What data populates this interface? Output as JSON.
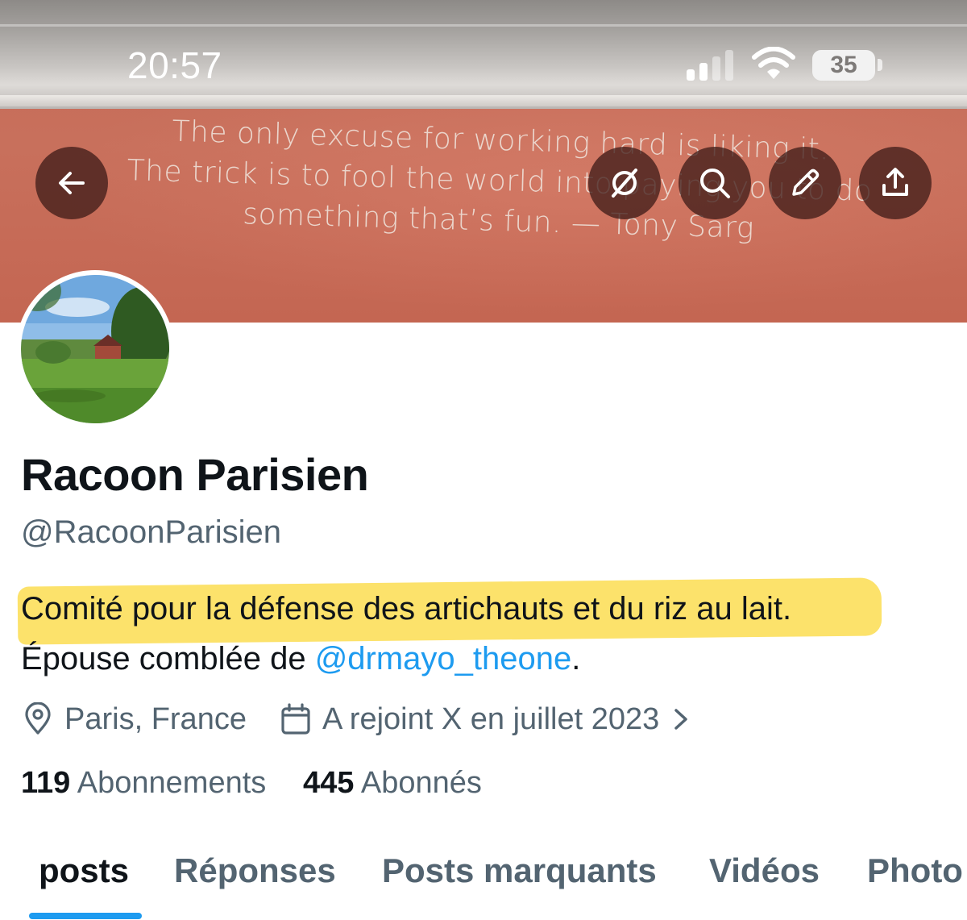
{
  "status_bar": {
    "time": "20:57",
    "battery_level": "35",
    "signal_icon": "cellular-signal-icon",
    "wifi_icon": "wifi-icon"
  },
  "banner": {
    "quote_lines": [
      "The only excuse for working hard is liking it.",
      "The trick is to fool the world into paying you to do",
      "something that’s fun. — Tony Sarg"
    ]
  },
  "header_buttons": {
    "back_icon": "arrow-left-icon",
    "grok_icon": "grok-icon",
    "search_icon": "search-icon",
    "edit_icon": "pencil-icon",
    "share_icon": "share-icon"
  },
  "profile": {
    "display_name": "Racoon Parisien",
    "handle": "@RacoonParisien",
    "bio_line1": "Comité pour la défense des artichauts et du riz au lait.",
    "bio_line2_prefix": "Épouse comblée de ",
    "bio_mention": "@drmayo_theone",
    "bio_line2_suffix": ".",
    "location": "Paris, France",
    "joined": "A rejoint X en juillet 2023",
    "following_count": "119",
    "following_label": "Abonnements",
    "followers_count": "445",
    "followers_label": "Abonnés"
  },
  "tabs": [
    {
      "label": "posts",
      "active": true
    },
    {
      "label": "Réponses",
      "active": false
    },
    {
      "label": "Posts marquants",
      "active": false
    },
    {
      "label": "Vidéos",
      "active": false
    },
    {
      "label": "Photo",
      "active": false
    }
  ],
  "colors": {
    "accent": "#1d9bf0",
    "highlight": "#fbdc4a",
    "secondary_text": "#536471",
    "primary_text": "#0f1419"
  }
}
